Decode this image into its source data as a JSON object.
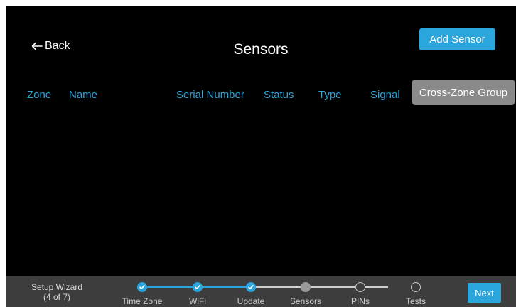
{
  "header": {
    "back_label": "Back",
    "back_icon": "arrow-left-icon",
    "title": "Sensors",
    "add_sensor_label": "Add Sensor"
  },
  "table": {
    "columns": [
      "Zone",
      "Name",
      "Serial Number",
      "Status",
      "Type",
      "Signal"
    ],
    "rows": [],
    "cross_zone_group_label": "Cross-Zone Group"
  },
  "wizard": {
    "title": "Setup Wizard",
    "progress_text": "(4 of 7)",
    "steps": [
      {
        "label": "Time Zone",
        "state": "done"
      },
      {
        "label": "WiFi",
        "state": "done"
      },
      {
        "label": "Update",
        "state": "done"
      },
      {
        "label": "Sensors",
        "state": "current"
      },
      {
        "label": "PINs",
        "state": "todo"
      },
      {
        "label": "Tests",
        "state": "todo"
      }
    ],
    "next_label": "Next"
  },
  "colors": {
    "accent": "#2aa6dc",
    "background": "#000000",
    "footer": "#3d3d3d",
    "secondary_button": "#8a8a8a"
  }
}
